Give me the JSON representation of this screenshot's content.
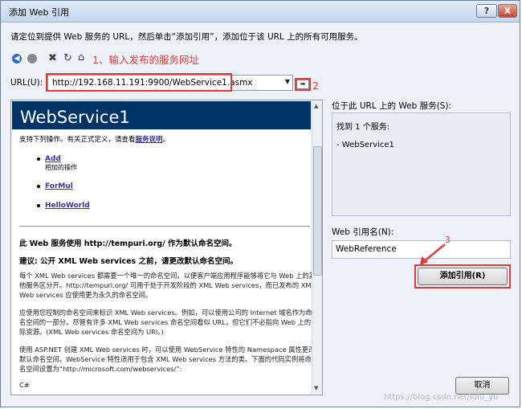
{
  "window": {
    "title": "添加 Web 引用",
    "help_label": "?",
    "close_label": "X"
  },
  "instruction": "请定位到提供 Web 服务的 URL，然后单击“添加引用”，添加位于该 URL 上的所有可用服务。",
  "toolbar": {
    "icons": [
      "back-icon",
      "forward-icon",
      "stop-icon",
      "refresh-icon",
      "home-icon"
    ],
    "annotation_1": "1、输入发布的服务网址"
  },
  "url": {
    "label": "URL(U):",
    "value": "http://192.168.11.191:9900/WebService1.asmx",
    "go_label": "➡",
    "annotation_2": "2"
  },
  "browser": {
    "title": "WebService1",
    "intro_text": "支持下列操作。有关正式定义，请查看",
    "intro_link": "服务说明",
    "intro_end": "。",
    "operations": [
      {
        "name": "Add",
        "desc": "相加的操作"
      },
      {
        "name": "ForMul",
        "desc": ""
      },
      {
        "name": "HelloWorld",
        "desc": ""
      }
    ],
    "ns_heading": "此 Web 服务使用 http://tempuri.org/ 作为默认命名空间。",
    "advice_heading": "建议: 公开 XML Web services 之前，请更改默认命名空间。",
    "para1": "每个 XML Web services 都需要一个唯一的命名空间，以便客户端应用程序能够将它与 Web 上的其他服务区分开。http://tempuri.org/ 可用于处于开发阶段的 XML Web services，而已发布的 XML Web services 应使用更为永久的命名空间。",
    "para2": "应使用您控制的命名空间来标识 XML Web services。例如，可以使用公司的 Internet 域名作为命名空间的一部分。尽管有许多 XML Web services 命名空间看似 URL，但它们不必指向 Web 上的实际资源。(XML Web services 命名空间为 URI。)",
    "para3": "使用 ASP.NET 创建 XML Web services 时，可以使用 WebService 特性的 Namespace 属性更改默认命名空间。WebService 特性适用于包含 XML Web services 方法的类。下面的代码实例将命名空间设置为“http://microsoft.com/webservices/”:",
    "para4": "C#"
  },
  "services_panel": {
    "label": "位于此 URL 上的 Web 服务(S):",
    "found_text": "找到 1 个服务:",
    "service_item": "- WebService1"
  },
  "reference": {
    "label": "Web 引用名(N):",
    "value": "WebReference",
    "add_button": "添加引用(R)",
    "annotation_3": "3"
  },
  "cancel_button": "取消",
  "watermark": "https://blog.csdn.net/lulu_yu",
  "colors": {
    "annotation": "#e23b3b",
    "header_bg": "#003366",
    "link": "#3333aa"
  }
}
